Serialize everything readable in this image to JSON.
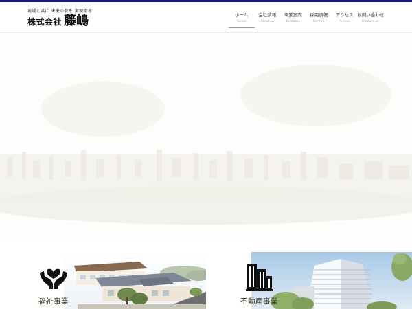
{
  "brand": {
    "tagline": "地域と共に 未来の夢を 実現する",
    "company_prefix": "株式会社",
    "company_name": "藤嶋",
    "accent_color": "#1a1a8c"
  },
  "nav": {
    "items": [
      {
        "label": "ホーム",
        "sub": "Home",
        "active": true
      },
      {
        "label": "会社情報",
        "sub": "About us",
        "active": false
      },
      {
        "label": "事業案内",
        "sub": "Business",
        "active": false
      },
      {
        "label": "採用情報",
        "sub": "Recruit",
        "active": false
      },
      {
        "label": "アクセス",
        "sub": "Access",
        "active": false
      },
      {
        "label": "お問い合わせ",
        "sub": "Contact us",
        "active": false
      }
    ]
  },
  "hero": {
    "image": "faded-cityscape-panorama"
  },
  "services": [
    {
      "label": "福祉事業",
      "icon": "hands-heart-icon",
      "image": "welfare-facility-building"
    },
    {
      "label": "不動産事業",
      "icon": "buildings-icon",
      "image": "apartment-tower"
    }
  ]
}
